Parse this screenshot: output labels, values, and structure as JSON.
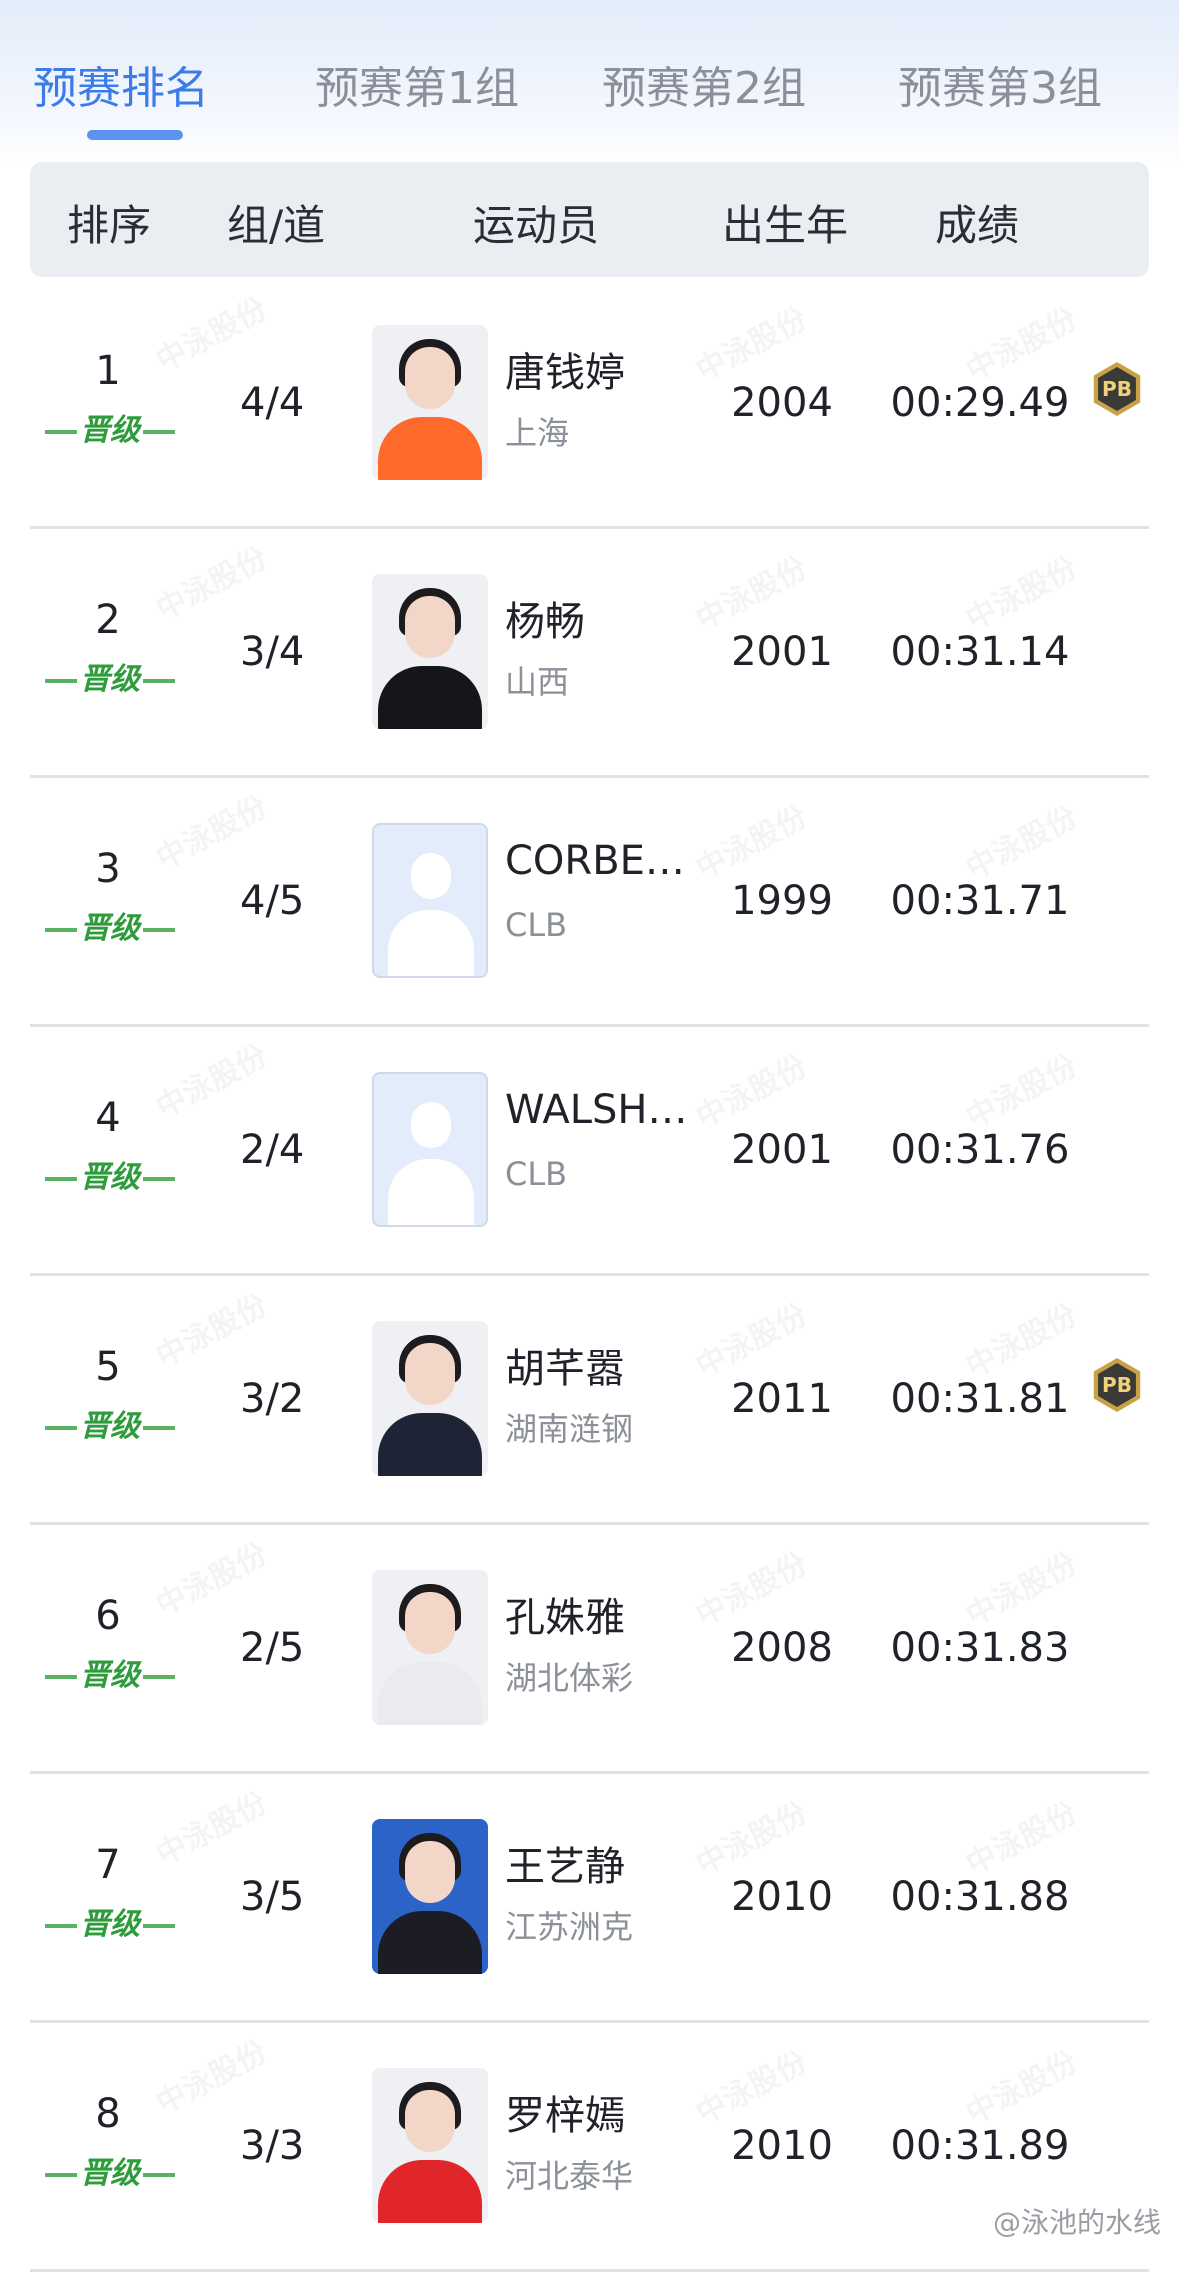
{
  "tabs": [
    {
      "label": "预赛排名",
      "active": true
    },
    {
      "label": "预赛第1组",
      "active": false
    },
    {
      "label": "预赛第2组",
      "active": false
    },
    {
      "label": "预赛第3组",
      "active": false
    }
  ],
  "header": {
    "rank": "排序",
    "lane": "组/道",
    "athlete": "运动员",
    "birth_year": "出生年",
    "result": "成绩"
  },
  "qualify_label": "晋级",
  "pb_label": "PB",
  "watermark": "中泳股份",
  "rows": [
    {
      "rank": "1",
      "lane": "4/4",
      "name": "唐钱婷",
      "team": "上海",
      "year": "2004",
      "time": "00:29.49",
      "pb": true,
      "avatar": "photo",
      "shirt": "#ff6a2b"
    },
    {
      "rank": "2",
      "lane": "3/4",
      "name": "杨畅",
      "team": "山西",
      "year": "2001",
      "time": "00:31.14",
      "pb": false,
      "avatar": "photo",
      "shirt": "#15161a"
    },
    {
      "rank": "3",
      "lane": "4/5",
      "name": "CORBE…",
      "team": "CLB",
      "year": "1999",
      "time": "00:31.71",
      "pb": false,
      "avatar": "placeholder"
    },
    {
      "rank": "4",
      "lane": "2/4",
      "name": "WALSH…",
      "team": "CLB",
      "year": "2001",
      "time": "00:31.76",
      "pb": false,
      "avatar": "placeholder"
    },
    {
      "rank": "5",
      "lane": "3/2",
      "name": "胡芊嚣",
      "team": "湖南涟钢",
      "year": "2011",
      "time": "00:31.81",
      "pb": true,
      "avatar": "photo",
      "shirt": "#1e2336"
    },
    {
      "rank": "6",
      "lane": "2/5",
      "name": "孔姝雅",
      "team": "湖北体彩",
      "year": "2008",
      "time": "00:31.83",
      "pb": false,
      "avatar": "photo",
      "shirt": "#e9ebee"
    },
    {
      "rank": "7",
      "lane": "3/5",
      "name": "王艺静",
      "team": "江苏洲克",
      "year": "2010",
      "time": "00:31.88",
      "pb": false,
      "avatar": "photo-blue",
      "shirt": "#1b1c24"
    },
    {
      "rank": "8",
      "lane": "3/3",
      "name": "罗梓嫣",
      "team": "河北泰华",
      "year": "2010",
      "time": "00:31.89",
      "pb": false,
      "avatar": "photo",
      "shirt": "#e0262a"
    }
  ],
  "footer": "@泳池的水线",
  "colors": {
    "accent": "#3c7cea",
    "qualify_green": "#2f9c3c",
    "pb_gold": "#c9a248"
  }
}
